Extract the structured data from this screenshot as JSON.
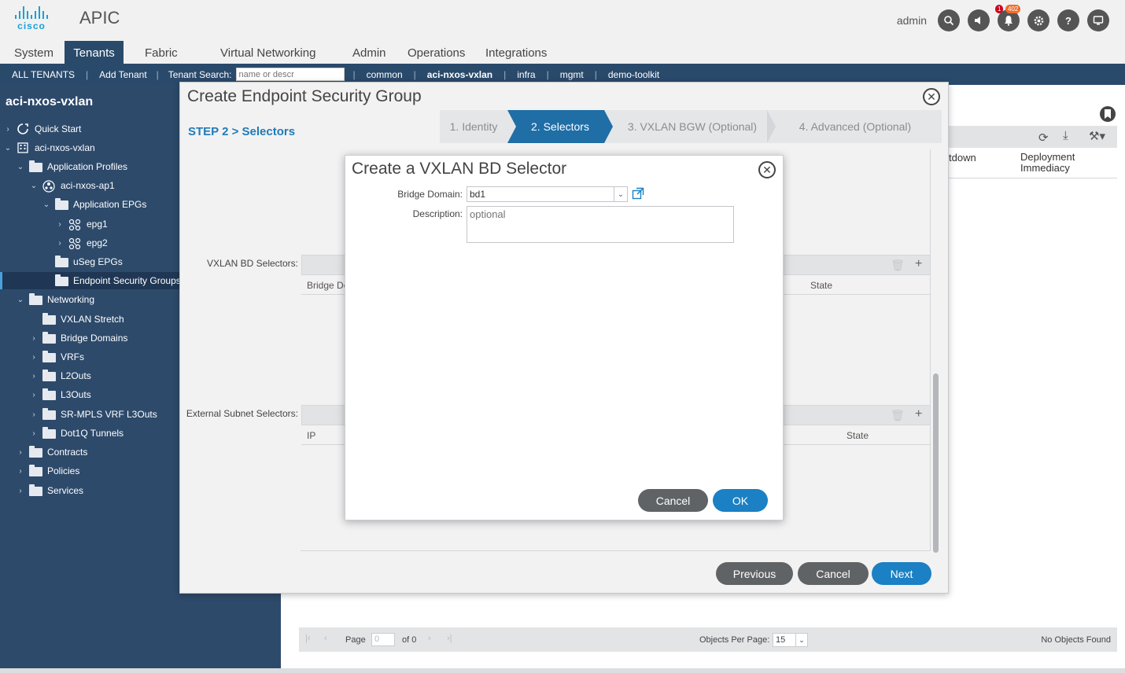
{
  "header": {
    "logo_text": "cisco",
    "app_title": "APIC",
    "user": "admin",
    "badge_alerts": "1",
    "badge_faults": "402",
    "colors": {
      "nav_dark": "#2a4a6b",
      "accent": "#1b80c4",
      "sidebar": "#2d4a6b"
    }
  },
  "main_nav": {
    "tabs": [
      {
        "label": "System"
      },
      {
        "label": "Tenants",
        "active": true
      },
      {
        "label": "Fabric"
      },
      {
        "label": "Virtual Networking"
      },
      {
        "label": "Admin"
      },
      {
        "label": "Operations"
      },
      {
        "label": "Integrations"
      }
    ]
  },
  "sub_nav": {
    "all_tenants": "ALL TENANTS",
    "add_tenant": "Add Tenant",
    "search_label": "Tenant Search:",
    "search_placeholder": "name or descr",
    "tenants": [
      "common",
      "aci-nxos-vxlan",
      "infra",
      "mgmt",
      "demo-toolkit"
    ]
  },
  "sidebar": {
    "title": "aci-nxos-vxlan",
    "items": [
      {
        "label": "Quick Start",
        "icon": "quick-start-icon"
      },
      {
        "label": "aci-nxos-vxlan",
        "icon": "tenant-icon"
      },
      {
        "label": "Application Profiles",
        "icon": "folder-icon"
      },
      {
        "label": "aci-nxos-ap1",
        "icon": "app-profile-icon"
      },
      {
        "label": "Application EPGs",
        "icon": "folder-icon"
      },
      {
        "label": "epg1",
        "icon": "epg-icon"
      },
      {
        "label": "epg2",
        "icon": "epg-icon"
      },
      {
        "label": "uSeg EPGs",
        "icon": "folder-icon"
      },
      {
        "label": "Endpoint Security Groups",
        "icon": "folder-icon"
      },
      {
        "label": "Networking",
        "icon": "folder-icon"
      },
      {
        "label": "VXLAN Stretch",
        "icon": "folder-icon"
      },
      {
        "label": "Bridge Domains",
        "icon": "folder-icon"
      },
      {
        "label": "VRFs",
        "icon": "folder-icon"
      },
      {
        "label": "L2Outs",
        "icon": "folder-icon"
      },
      {
        "label": "L3Outs",
        "icon": "folder-icon"
      },
      {
        "label": "SR-MPLS VRF L3Outs",
        "icon": "folder-icon"
      },
      {
        "label": "Dot1Q Tunnels",
        "icon": "folder-icon"
      },
      {
        "label": "Contracts",
        "icon": "folder-icon"
      },
      {
        "label": "Policies",
        "icon": "folder-icon"
      },
      {
        "label": "Services",
        "icon": "folder-icon"
      }
    ]
  },
  "background": {
    "col_breakdown": "tdown",
    "col_deployment_1": "Deployment",
    "col_deployment_2": "Immediacy",
    "pager": {
      "page_label": "Page",
      "page_value": "0",
      "of_label": "of 0",
      "per_page_label": "Objects Per Page:",
      "per_page_value": "15",
      "no_objects": "No Objects Found"
    }
  },
  "wizard": {
    "title": "Create Endpoint Security Group",
    "step_label": "STEP 2 > Selectors",
    "steps": [
      "1. Identity",
      "2. Selectors",
      "3. VXLAN BGW (Optional)",
      "4. Advanced (Optional)"
    ],
    "vxlan_label": "VXLAN BD Selectors:",
    "vxlan_col_bd": "Bridge De",
    "vxlan_col_state": "State",
    "ext_label": "External Subnet Selectors:",
    "ext_col_ip": "IP",
    "ext_col_state": "State",
    "btn_previous": "Previous",
    "btn_cancel": "Cancel",
    "btn_next": "Next"
  },
  "bd_dialog": {
    "title": "Create a VXLAN BD Selector",
    "bd_label": "Bridge Domain:",
    "bd_value": "bd1",
    "desc_label": "Description:",
    "desc_placeholder": "optional",
    "btn_cancel": "Cancel",
    "btn_ok": "OK"
  }
}
